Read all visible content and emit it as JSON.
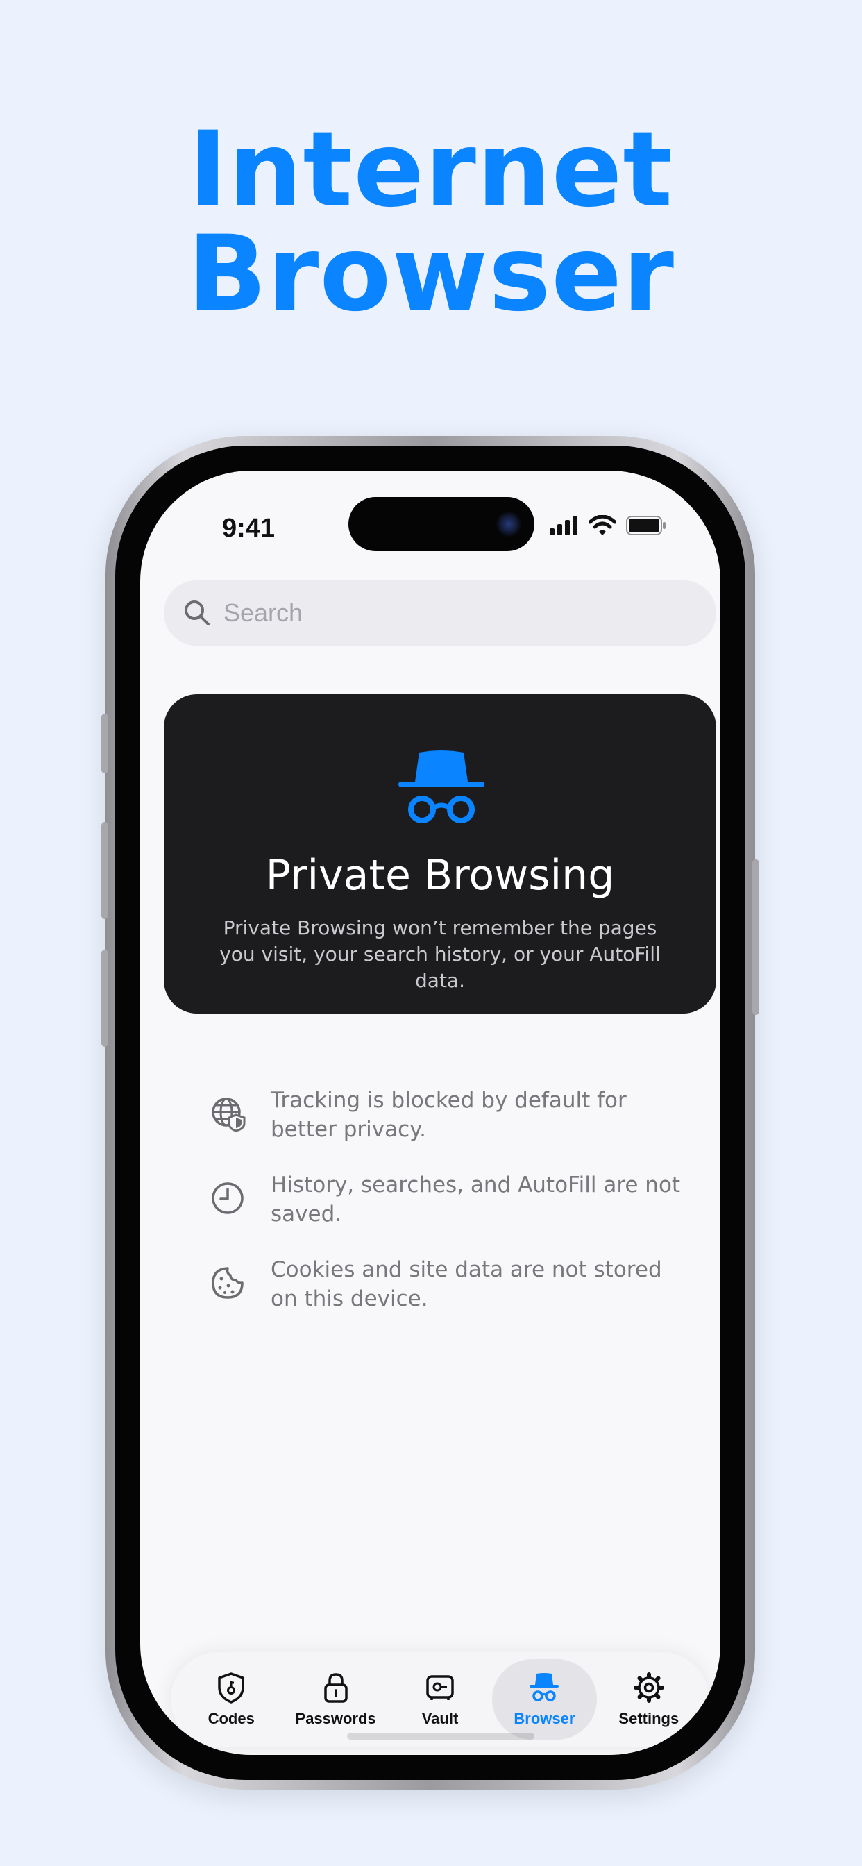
{
  "headline": {
    "line1": "Internet",
    "line2": "Browser"
  },
  "status_bar": {
    "time": "9:41"
  },
  "search": {
    "placeholder": "Search"
  },
  "private_card": {
    "title": "Private Browsing",
    "description": "Private Browsing won’t remember the pages you visit, your search history, or your AutoFill data."
  },
  "features": [
    {
      "icon": "globe-shield-icon",
      "text": "Tracking is blocked by default for better privacy."
    },
    {
      "icon": "clock-icon",
      "text": "History, searches, and AutoFill are not saved."
    },
    {
      "icon": "cookie-icon",
      "text": "Cookies and site data are not stored on this device."
    }
  ],
  "tabs": [
    {
      "label": "Codes",
      "icon": "shield-key-icon"
    },
    {
      "label": "Passwords",
      "icon": "lock-icon"
    },
    {
      "label": "Vault",
      "icon": "vault-icon"
    },
    {
      "label": "Browser",
      "icon": "incognito-icon",
      "active": true
    },
    {
      "label": "Settings",
      "icon": "gear-icon"
    }
  ],
  "colors": {
    "accent": "#0a84ff",
    "background": "#ebf2fe",
    "card": "#1c1c1e"
  }
}
